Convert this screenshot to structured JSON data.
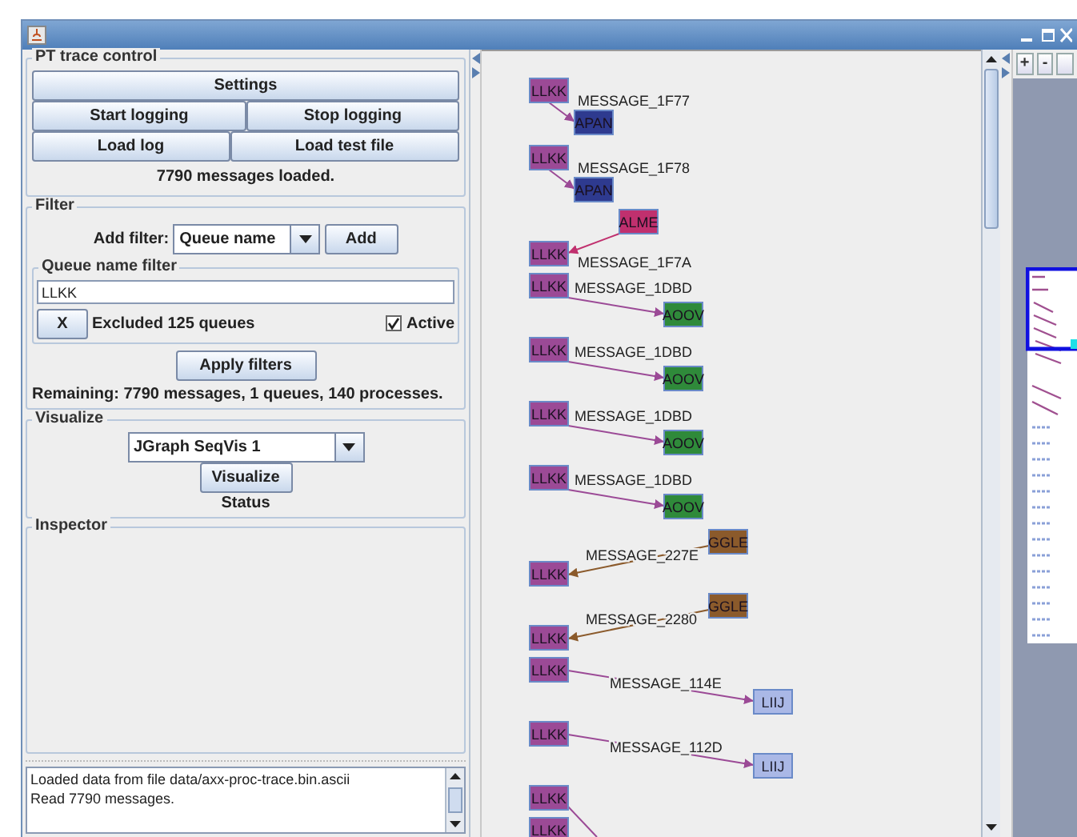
{
  "trace_control": {
    "title": "PT trace control",
    "button_rows": [
      [
        "Settings"
      ],
      [
        "Start logging",
        "Stop logging"
      ],
      [
        "Load log",
        "Load test file"
      ]
    ],
    "status": "7790 messages loaded."
  },
  "filter": {
    "title": "Filter",
    "add_label": "Add filter:",
    "filter_type": "Queue name",
    "add_button": "Add",
    "queue_filter": {
      "title": "Queue name filter",
      "value": "LLKK",
      "remove_button": "X",
      "excluded": "Excluded 125 queues",
      "active": {
        "label": "Active",
        "checked": true
      }
    },
    "apply_button": "Apply filters",
    "remaining": "Remaining: 7790 messages, 1 queues, 140 processes."
  },
  "visualize": {
    "title": "Visualize",
    "visualizer": "JGraph SeqVis 1",
    "button": "Visualize",
    "status": "Status"
  },
  "inspector": {
    "title": "Inspector"
  },
  "log": {
    "lines": [
      "Loaded data from file data/axx-proc-trace.bin.ascii",
      "Read 7790 messages."
    ]
  },
  "graph": {
    "messages": [
      {
        "label": "MESSAGE_1F77",
        "from": {
          "name": "LLKK",
          "color": "#9b4a96"
        },
        "to": {
          "name": "APAN",
          "color": "#2e3a8f"
        }
      },
      {
        "label": "MESSAGE_1F78",
        "from": {
          "name": "LLKK",
          "color": "#9b4a96"
        },
        "to": {
          "name": "APAN",
          "color": "#2e3a8f"
        }
      },
      {
        "label": "MESSAGE_1F7A",
        "from": {
          "name": "ALME",
          "color": "#c0306e"
        },
        "to": {
          "name": "LLKK",
          "color": "#9b4a96"
        }
      },
      {
        "label": "MESSAGE_1DBD",
        "from": {
          "name": "LLKK",
          "color": "#9b4a96"
        },
        "to": {
          "name": "AOOV",
          "color": "#2f8a3a"
        }
      },
      {
        "label": "MESSAGE_1DBD",
        "from": {
          "name": "LLKK",
          "color": "#9b4a96"
        },
        "to": {
          "name": "AOOV",
          "color": "#2f8a3a"
        }
      },
      {
        "label": "MESSAGE_1DBD",
        "from": {
          "name": "LLKK",
          "color": "#9b4a96"
        },
        "to": {
          "name": "AOOV",
          "color": "#2f8a3a"
        }
      },
      {
        "label": "MESSAGE_1DBD",
        "from": {
          "name": "LLKK",
          "color": "#9b4a96"
        },
        "to": {
          "name": "AOOV",
          "color": "#2f8a3a"
        }
      },
      {
        "label": "MESSAGE_227E",
        "from": {
          "name": "GGLE",
          "color": "#8b5a2b"
        },
        "to": {
          "name": "LLKK",
          "color": "#9b4a96"
        }
      },
      {
        "label": "MESSAGE_2280",
        "from": {
          "name": "GGLE",
          "color": "#8b5a2b"
        },
        "to": {
          "name": "LLKK",
          "color": "#9b4a96"
        }
      },
      {
        "label": "MESSAGE_114E",
        "from": {
          "name": "LLKK",
          "color": "#9b4a96"
        },
        "to": {
          "name": "LIIJ",
          "color": "#aab8e6"
        }
      },
      {
        "label": "MESSAGE_112D",
        "from": {
          "name": "LLKK",
          "color": "#9b4a96"
        },
        "to": {
          "name": "LIIJ",
          "color": "#aab8e6"
        }
      },
      {
        "from": {
          "name": "LLKK",
          "color": "#9b4a96"
        }
      },
      {
        "from": {
          "name": "LLKK",
          "color": "#9b4a96"
        }
      }
    ]
  },
  "overview": {
    "toolbar": [
      "+",
      "-"
    ]
  }
}
